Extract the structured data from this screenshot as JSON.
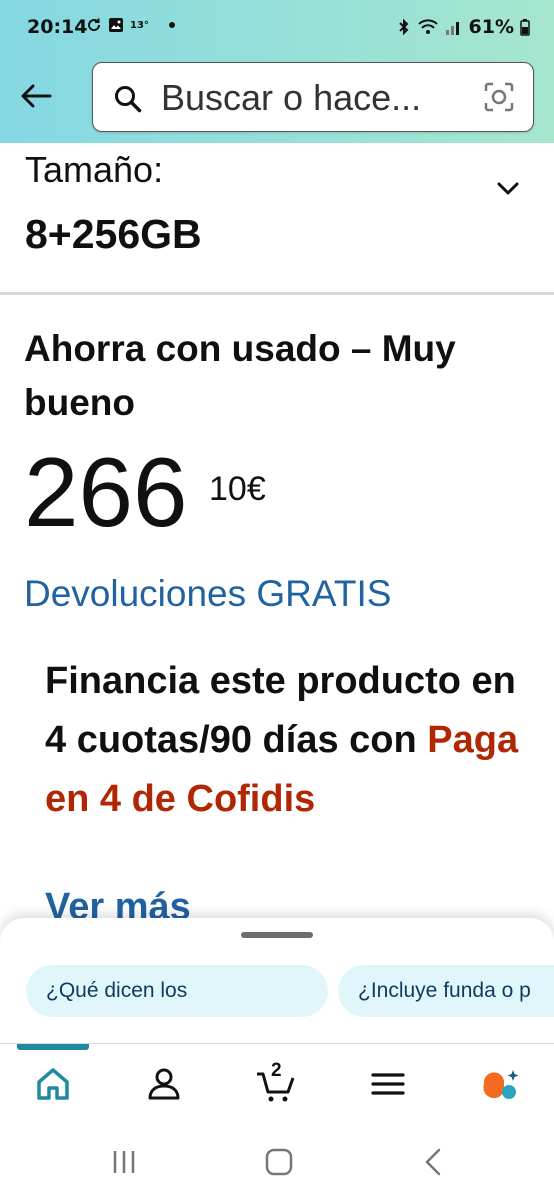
{
  "status_bar": {
    "time": "20:14",
    "temperature": "13°",
    "battery": "61%"
  },
  "search": {
    "placeholder": "Buscar o hace..."
  },
  "size_selector": {
    "label": "Tamaño:",
    "value": "8+256GB"
  },
  "offer": {
    "title": "Ahorra con usado – Muy bueno",
    "price_whole": "266",
    "price_fraction": "10€",
    "returns": "Devoluciones GRATIS"
  },
  "financing": {
    "text": "Financia este producto en 4 cuotas/90 días con",
    "highlight": "Paga en 4 de Cofidis",
    "see_more": "Ver más"
  },
  "suggestions": [
    {
      "label": "¿Qué dicen los"
    },
    {
      "label": "¿Incluye funda o p"
    }
  ],
  "bottom_nav": {
    "cart_count": "2",
    "items": [
      {
        "icon": "home-icon",
        "active": true
      },
      {
        "icon": "account-icon",
        "active": false
      },
      {
        "icon": "cart-icon",
        "active": false
      },
      {
        "icon": "menu-icon",
        "active": false
      },
      {
        "icon": "rufus-icon",
        "active": false
      }
    ]
  },
  "colors": {
    "header_gradient_start": "#84d8e3",
    "header_gradient_end": "#a6e6ce",
    "link": "#2162a1",
    "price_highlight": "#b12704",
    "nav_active": "#1f8a9f",
    "chip_background": "#e0f6fb"
  }
}
